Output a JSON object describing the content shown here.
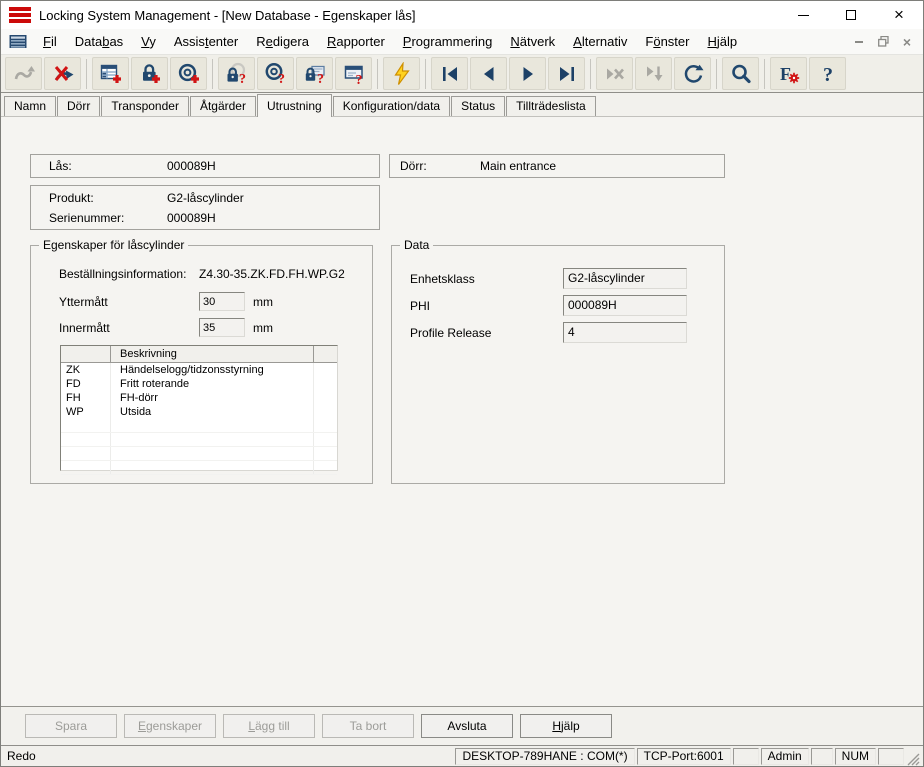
{
  "window": {
    "title": "Locking System Management - [New Database - Egenskaper lås]"
  },
  "menu": {
    "items": [
      {
        "label": "Fil",
        "u": 0
      },
      {
        "label": "Databas",
        "u": 4
      },
      {
        "label": "Vy",
        "u": 0
      },
      {
        "label": "Assistenter",
        "u": 5
      },
      {
        "label": "Redigera",
        "u": 1
      },
      {
        "label": "Rapporter",
        "u": 0
      },
      {
        "label": "Programmering",
        "u": 0
      },
      {
        "label": "Nätverk",
        "u": 0
      },
      {
        "label": "Alternativ",
        "u": 0
      },
      {
        "label": "Fönster",
        "u": 1
      },
      {
        "label": "Hjälp",
        "u": 0
      }
    ]
  },
  "toolbar": {
    "buttons": [
      {
        "icon": "undo-icon",
        "disabled": true
      },
      {
        "icon": "disconnect-icon",
        "disabled": false
      },
      {
        "icon": "new-locking-system-icon",
        "disabled": false
      },
      {
        "icon": "new-lock-icon",
        "disabled": false
      },
      {
        "icon": "new-transponder-icon",
        "disabled": false
      },
      {
        "icon": "read-lock-icon",
        "disabled": false
      },
      {
        "icon": "read-transponder-icon",
        "disabled": false
      },
      {
        "icon": "read-g1-lock-icon",
        "disabled": false
      },
      {
        "icon": "read-network-icon",
        "disabled": false
      },
      {
        "icon": "program-lightning-icon",
        "disabled": false
      },
      {
        "icon": "first-record-icon",
        "disabled": false
      },
      {
        "icon": "previous-record-icon",
        "disabled": false
      },
      {
        "icon": "next-record-icon",
        "disabled": false
      },
      {
        "icon": "last-record-icon",
        "disabled": false
      },
      {
        "icon": "remove-record-icon",
        "disabled": true
      },
      {
        "icon": "apply-record-icon",
        "disabled": true
      },
      {
        "icon": "refresh-icon",
        "disabled": false
      },
      {
        "icon": "search-icon",
        "disabled": false
      },
      {
        "icon": "filter-icon",
        "disabled": false
      },
      {
        "icon": "help-icon",
        "disabled": false
      }
    ]
  },
  "tabs": {
    "active_index": 4,
    "items": [
      {
        "label": "Namn"
      },
      {
        "label": "Dörr"
      },
      {
        "label": "Transponder"
      },
      {
        "label": "Åtgärder"
      },
      {
        "label": "Utrustning"
      },
      {
        "label": "Konfiguration/data"
      },
      {
        "label": "Status"
      },
      {
        "label": "Tillträdeslista"
      }
    ]
  },
  "fields": {
    "lock_label": "Lås:",
    "lock_value": "000089H",
    "door_label": "Dörr:",
    "door_value": "Main entrance",
    "product_label": "Produkt:",
    "product_value": "G2-låscylinder",
    "serial_label": "Serienummer:",
    "serial_value": "000089H"
  },
  "equipment": {
    "group_title": "Egenskaper för låscylinder",
    "order_info_label": "Beställningsinformation:",
    "order_info_value": "Z4.30-35.ZK.FD.FH.WP.G2",
    "outer_label": "Yttermått",
    "outer_value": "30",
    "outer_unit": "mm",
    "inner_label": "Innermått",
    "inner_value": "35",
    "inner_unit": "mm",
    "table": {
      "header": "Beskrivning",
      "rows": [
        {
          "code": "ZK",
          "desc": "Händelselogg/tidzonsstyrning"
        },
        {
          "code": "FD",
          "desc": "Fritt roterande"
        },
        {
          "code": "FH",
          "desc": "FH-dörr"
        },
        {
          "code": "WP",
          "desc": "Utsida"
        }
      ]
    }
  },
  "data_group": {
    "title": "Data",
    "rows": [
      {
        "label": "Enhetsklass",
        "value": "G2-låscylinder"
      },
      {
        "label": "PHI",
        "value": "000089H"
      },
      {
        "label": "Profile Release",
        "value": "4"
      }
    ]
  },
  "footer": {
    "buttons": [
      {
        "label": "Spara",
        "u": -1,
        "disabled": true
      },
      {
        "label": "Egenskaper",
        "u": 0,
        "disabled": true
      },
      {
        "label": "Lägg till",
        "u": 0,
        "disabled": true
      },
      {
        "label": "Ta bort",
        "u": -1,
        "disabled": true
      },
      {
        "label": "Avsluta",
        "u": -1,
        "disabled": false
      },
      {
        "label": "Hjälp",
        "u": 0,
        "disabled": false
      }
    ]
  },
  "statusbar": {
    "ready": "Redo",
    "host": "DESKTOP-789HANE : COM(*)",
    "tcp": "TCP-Port:6001",
    "user": "Admin",
    "num": "NUM"
  },
  "colors": {
    "accent_red": "#cc0a0a",
    "icon_navy": "#1d4167",
    "bolt_yellow": "#ffd21e"
  }
}
